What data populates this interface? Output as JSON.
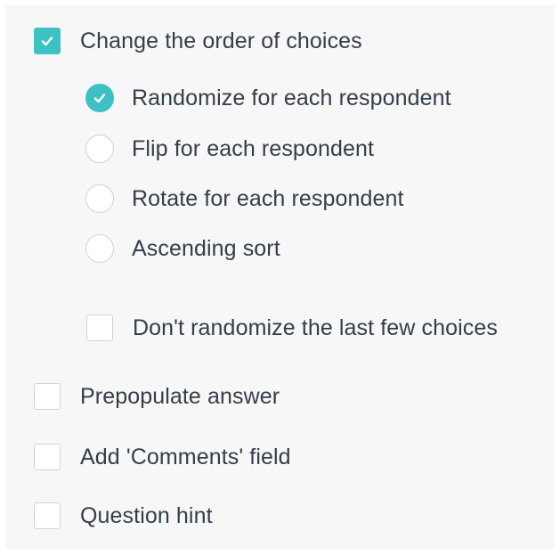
{
  "options": {
    "change_order": {
      "label": "Change the order of choices",
      "checked": true
    },
    "order_modes": [
      {
        "label": "Randomize for each respondent",
        "selected": true
      },
      {
        "label": "Flip for each respondent",
        "selected": false
      },
      {
        "label": "Rotate for each respondent",
        "selected": false
      },
      {
        "label": "Ascending sort",
        "selected": false
      }
    ],
    "dont_randomize_last": {
      "label": "Don't randomize the last few choices",
      "checked": false
    },
    "prepopulate": {
      "label": "Prepopulate answer",
      "checked": false
    },
    "comments_field": {
      "label": "Add 'Comments' field",
      "checked": false
    },
    "question_hint": {
      "label": "Question hint",
      "checked": false
    }
  },
  "colors": {
    "accent": "#3ec1c3",
    "text": "#333e48",
    "border": "#cfd3d7",
    "panel_bg": "#f7f7f8"
  },
  "icons": {
    "checkmark": "checkmark-icon"
  }
}
